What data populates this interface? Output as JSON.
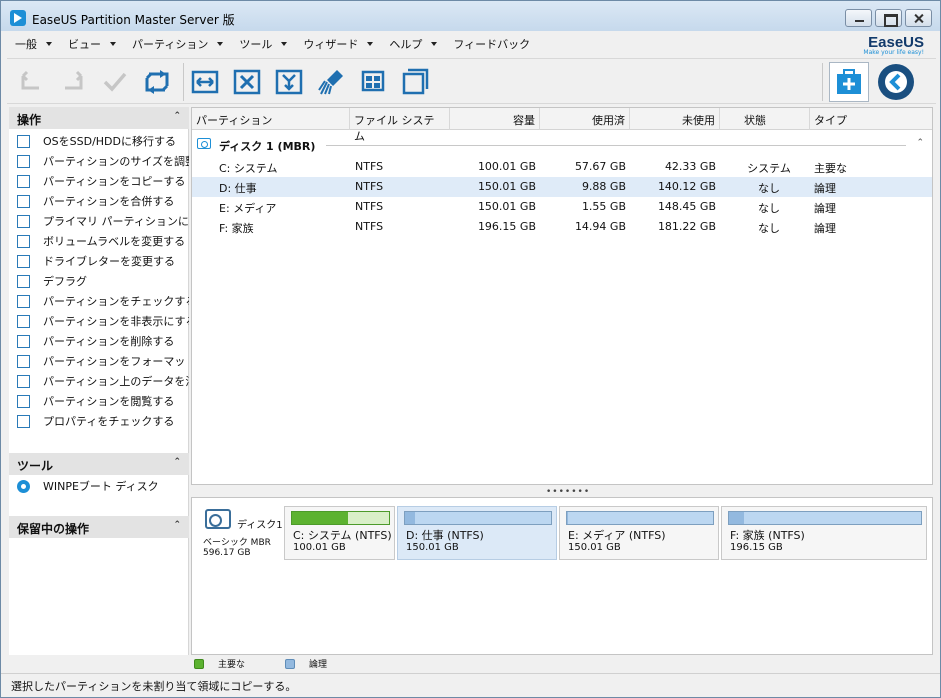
{
  "window": {
    "title": "EaseUS Partition Master Server 版"
  },
  "menu": [
    {
      "label": "一般"
    },
    {
      "label": "ビュー"
    },
    {
      "label": "パーティション"
    },
    {
      "label": "ツール"
    },
    {
      "label": "ウィザード"
    },
    {
      "label": "ヘルプ"
    },
    {
      "label": "フィードバック"
    }
  ],
  "logo": {
    "name": "EaseUS",
    "tagline": "Make your life easy!"
  },
  "toolbar": {
    "icons": [
      "undo-icon",
      "redo-icon",
      "apply-icon",
      "refresh-icon",
      "resize-icon",
      "delete-icon",
      "merge-icon",
      "format-icon",
      "wipe-icon",
      "copy-icon",
      "backup-icon",
      "next-icon"
    ]
  },
  "left": {
    "operations_title": "操作",
    "operations": [
      {
        "label": "OSをSSD/HDDに移行する",
        "icon": "migrate-os-icon"
      },
      {
        "label": "パーティションのサイズを調整或",
        "icon": "resize-icon"
      },
      {
        "label": "パーティションをコピーする",
        "icon": "copy-icon"
      },
      {
        "label": "パーティションを合併する",
        "icon": "merge-icon"
      },
      {
        "label": "プライマリ パーティションに変換す",
        "icon": "convert-icon"
      },
      {
        "label": "ボリュームラベルを変更する",
        "icon": "label-icon"
      },
      {
        "label": "ドライブレターを変更する",
        "icon": "drive-letter-icon"
      },
      {
        "label": "デフラグ",
        "icon": "defrag-icon"
      },
      {
        "label": "パーティションをチェックする",
        "icon": "check-icon"
      },
      {
        "label": "パーティションを非表示にする",
        "icon": "hide-icon"
      },
      {
        "label": "パーティションを削除する",
        "icon": "delete-icon"
      },
      {
        "label": "パーティションをフォーマットする",
        "icon": "format-icon"
      },
      {
        "label": "パーティション上のデータを消去",
        "icon": "wipe-icon"
      },
      {
        "label": "パーティションを閲覧する",
        "icon": "explore-icon"
      },
      {
        "label": "プロパティをチェックする",
        "icon": "properties-icon"
      }
    ],
    "tools_title": "ツール",
    "tools": [
      {
        "label": "WINPEブート ディスク",
        "icon": "disc-icon"
      }
    ],
    "pending_title": "保留中の操作"
  },
  "table": {
    "headers": [
      "パーティション",
      "ファイル システム",
      "容量",
      "使用済",
      "未使用",
      "状態",
      "タイプ"
    ],
    "disk_label": "ディスク 1 (MBR)",
    "rows": [
      {
        "partition": "C: システム",
        "fs": "NTFS",
        "capacity": "100.01 GB",
        "used": "57.67 GB",
        "unused": "42.33 GB",
        "status": "システム",
        "type": "主要な"
      },
      {
        "partition": "D: 仕事",
        "fs": "NTFS",
        "capacity": "150.01 GB",
        "used": "9.88 GB",
        "unused": "140.12 GB",
        "status": "なし",
        "type": "論理"
      },
      {
        "partition": "E: メディア",
        "fs": "NTFS",
        "capacity": "150.01 GB",
        "used": "1.55 GB",
        "unused": "148.45 GB",
        "status": "なし",
        "type": "論理"
      },
      {
        "partition": "F: 家族",
        "fs": "NTFS",
        "capacity": "196.15 GB",
        "used": "14.94 GB",
        "unused": "181.22 GB",
        "status": "なし",
        "type": "論理"
      }
    ],
    "selected_row": 1
  },
  "diskmap": {
    "disk_name": "ディスク1",
    "disk_type": "ベーシック MBR",
    "disk_size": "596.17 GB",
    "partitions": [
      {
        "name": "C: システム (NTFS)",
        "size": "100.01 GB",
        "used_fraction": 0.58,
        "kind": "primary"
      },
      {
        "name": "D: 仕事 (NTFS)",
        "size": "150.01 GB",
        "used_fraction": 0.07,
        "kind": "logical"
      },
      {
        "name": "E: メディア (NTFS)",
        "size": "150.01 GB",
        "used_fraction": 0.01,
        "kind": "logical"
      },
      {
        "name": "F: 家族 (NTFS)",
        "size": "196.15 GB",
        "used_fraction": 0.08,
        "kind": "logical"
      }
    ]
  },
  "legend": {
    "primary": "主要な",
    "logical": "論理",
    "primary_color": "#5cb230",
    "logical_color": "#93b9df"
  },
  "status": {
    "text": "選択したパーティションを未割り当て領域にコピーする。"
  }
}
